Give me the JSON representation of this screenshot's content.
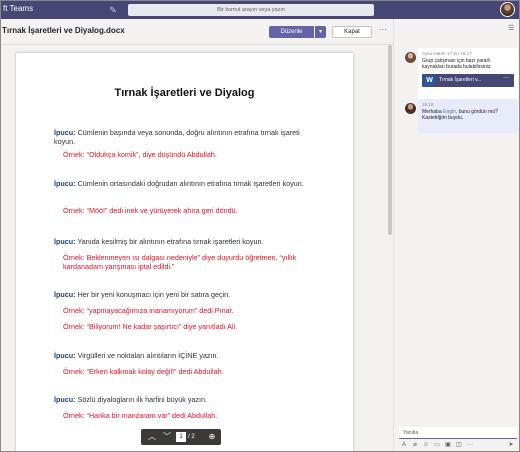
{
  "app": {
    "title": "ft Teams"
  },
  "search": {
    "placeholder": "Bir komut arayın veya yazın"
  },
  "doc_toolbar": {
    "title": "Tırnak İşaretleri ve Diyalog.docx",
    "edit_label": "Düzenle",
    "close_label": "Kapat"
  },
  "document": {
    "heading": "Tırnak İşaretleri ve Diyalog",
    "tip_label": "İpucu:",
    "example_label": "Örnek:",
    "sections": [
      {
        "tip": "Cümlenin başında veya sonunda, doğru alıntının etrafına tırnak işareti koyun.",
        "examples": [
          "“Oldukça komik”, diye düşündü Abdullah."
        ]
      },
      {
        "tip": "Cümlenin ortasındaki doğrudan alıntının etrafına tırnak işaretleri koyun.",
        "examples": [
          "“Möö!” dedi inek ve yürüyerek ahıra geri döndü."
        ]
      },
      {
        "tip": "Yanıda kesilmiş bir alıntının etrafına tırnak işaretleri koyun.",
        "examples": [
          "Beklenmeyen ısı dalgası nedeniyle” diye duyurdu öğretmen, “yıllık kardanadam yarışması iptal edildi.”"
        ]
      },
      {
        "tip": "Her bir yeni konuşmacı için yeni bir satıra geçin.",
        "examples": [
          "“yapmayacağımıza inanamıyorum” dedi Pınar.",
          "“Biliyorum! Ne kadar şaşırtıcı” diye yanıtladı Ali."
        ]
      },
      {
        "tip": "Virgülleri ve noktaları alıntıların İÇİNE yazın.",
        "examples": [
          "“Erken kalkmak kolay değil!” dedi Abdullah."
        ]
      },
      {
        "tip": "Sözlü diyalogların ilk harfini büyük yazın.",
        "examples": [
          "“Harika bir manzaram var” dedi Abdullah."
        ]
      }
    ]
  },
  "pager": {
    "current_page": "1",
    "total": "/ 2"
  },
  "chat": {
    "messages": [
      {
        "meta": "Aysu Hatırlı  17 Ko 16.17",
        "text": "Grup çalışması için bazı yararlı kaynakları burada bulabilirsiniz.",
        "attachment": "Tırnak İşaretleri v..."
      },
      {
        "meta": "16.18",
        "text_before": "Merhaba ",
        "mention": "Engin",
        "text_after": ", bunu gördün mü? Kastettiğim buydu."
      }
    ],
    "reply_placeholder": "Yanıtla"
  },
  "colors": {
    "teams_purple": "#464775",
    "accent": "#6264a7",
    "example_red": "#e81123",
    "tip_blue": "#1f3f7a"
  },
  "icons": {
    "compose": "compose-icon",
    "more": "more-icon",
    "chat_header": "chat-icon",
    "up": "chevron-up-icon",
    "down": "chevron-down-icon",
    "zoom": "zoom-icon",
    "word": "word-file-icon"
  }
}
